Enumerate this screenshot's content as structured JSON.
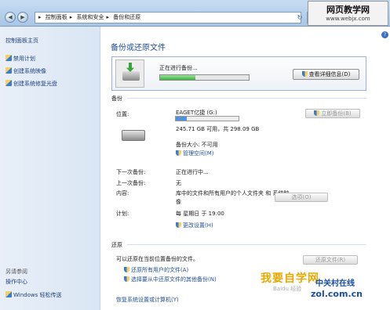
{
  "address_bar": {
    "crumbs": [
      "控制面板",
      "系统和安全",
      "备份和还原"
    ]
  },
  "watermark_top": {
    "line1": "网页教学网",
    "line2": "www.webjx.com"
  },
  "sidebar": {
    "home": "控制面板主页",
    "links": [
      "禁用计划",
      "创建系统映像",
      "创建系统修复光盘"
    ],
    "see_also": "另请参阅",
    "see_also_links": [
      "操作中心",
      "Windows 轻松传送"
    ]
  },
  "main": {
    "title": "备份或还原文件",
    "progress_label": "正在进行备份...",
    "progress_fraction": 0.4,
    "details_button": "查看详细信息(D)",
    "backup_section": "备份",
    "location_label": "位置:",
    "drive_name": "EAGET亿捷 (G:)",
    "drive_used_fraction": 0.18,
    "drive_space": "245.71 GB 可用，共 298.09 GB",
    "backup_now_button": "立即备份(B)",
    "backup_size": "备份大小: 不可用",
    "manage_space": "管理空间(M)",
    "next_backup_label": "下一次备份:",
    "next_backup": "正在进行中...",
    "last_backup_label": "上一次备份:",
    "last_backup": "无",
    "contents_label": "内容:",
    "contents_line1": "库中的文件和所有用户的个人文件夹 和 系统映",
    "contents_line2": "像",
    "schedule_label": "计划:",
    "schedule": "每 星期日 于 19:00",
    "change_settings": "更改设置(H)",
    "options_button": "选项(O)",
    "restore_section": "还原",
    "restore_text": "可以还原在当前位置备份的文件。",
    "restore_mine": "还原所有用户的文件(A)",
    "restore_other": "选择要从中还原文件的其他备份(N)",
    "restore_files_button": "还原文件(R)",
    "restore_system": "恢复系统设置或计算机(Y)"
  },
  "watermark_bottom": {
    "brand1": "我要自学网",
    "brand2": "中关村在线",
    "brand3": "zol.com.cn",
    "brand4": "Baidu 经验"
  }
}
